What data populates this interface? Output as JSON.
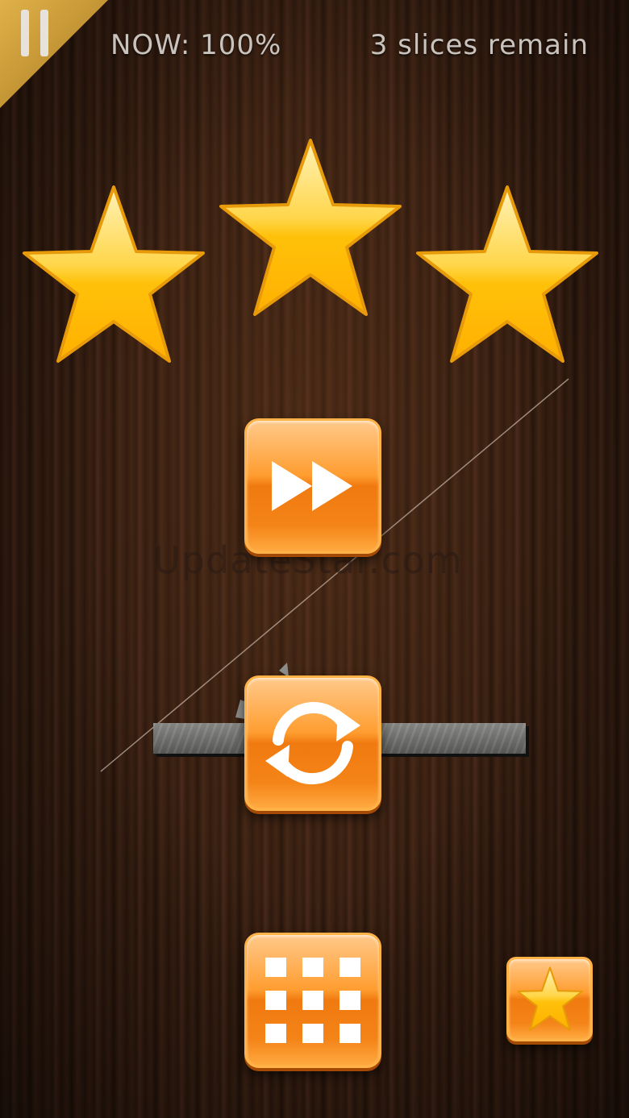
{
  "hud": {
    "now_label": "NOW: 100%",
    "slices_label": "3 slices remain"
  },
  "rating": {
    "stars_earned": 3,
    "stars_total": 3
  },
  "watermark": "UpdateStar.com",
  "buttons": {
    "pause": "pause-icon",
    "next_level": "fast-forward-icon",
    "restart": "refresh-icon",
    "level_select": "grid-icon",
    "rate": "star-icon"
  },
  "colors": {
    "button_orange": "#f48418",
    "star_gold": "#ffc21a",
    "pause_tab_gold": "#c8962e",
    "hud_text": "#c9c3bd"
  }
}
